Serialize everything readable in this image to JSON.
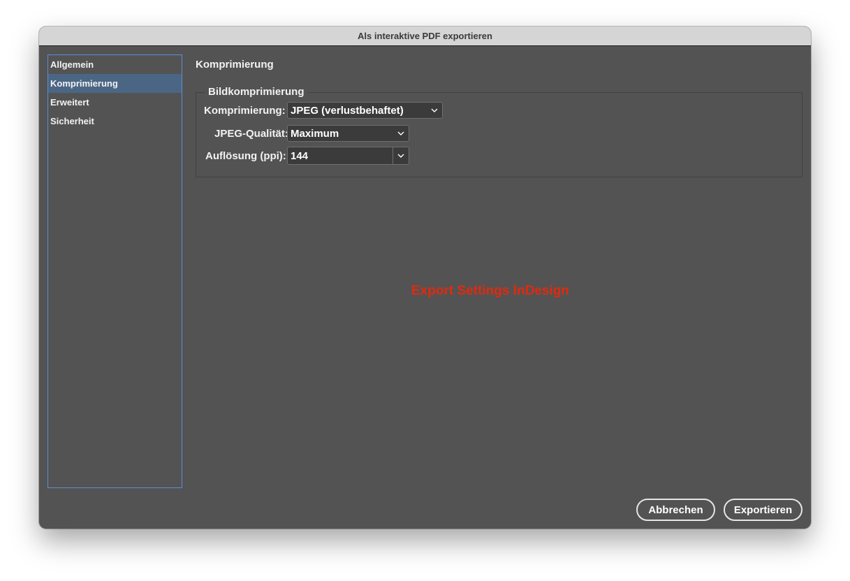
{
  "window": {
    "title": "Als interaktive PDF exportieren"
  },
  "sidebar": {
    "items": [
      {
        "label": "Allgemein"
      },
      {
        "label": "Komprimierung"
      },
      {
        "label": "Erweitert"
      },
      {
        "label": "Sicherheit"
      }
    ],
    "selected": "Komprimierung"
  },
  "main": {
    "section_title": "Komprimierung",
    "group_title": "Bildkomprimierung",
    "fields": [
      {
        "label": "Komprimierung:",
        "value": "JPEG (verlustbehaftet)",
        "icon": "chevron-down-icon"
      },
      {
        "label": "JPEG-Qualität:",
        "value": "Maximum",
        "icon": "chevron-down-icon"
      },
      {
        "label": "Auflösung (ppi):",
        "value": "144",
        "icon": "chevron-down-icon"
      }
    ],
    "watermark": "Export Settings InDesign"
  },
  "footer": {
    "cancel_label": "Abbrechen",
    "export_label": "Exportieren"
  },
  "colors": {
    "panel_bg": "#535353",
    "titlebar_bg": "#d5d5d5",
    "sidebar_border": "#5b8ed6",
    "sidebar_selected": "#4b6685",
    "watermark": "#e02a0f"
  }
}
